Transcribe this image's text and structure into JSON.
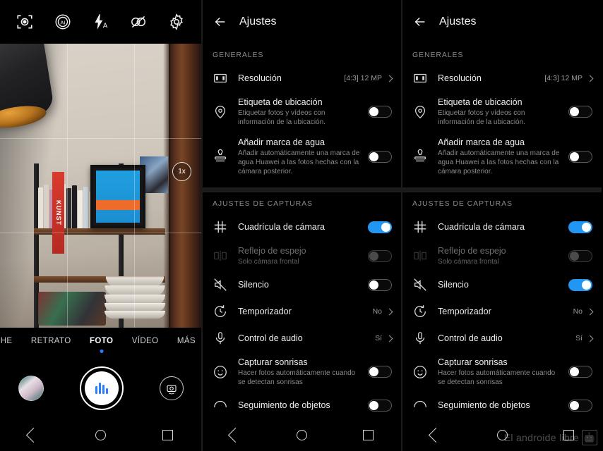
{
  "camera": {
    "topbar_icons": [
      {
        "name": "ai-focus-icon",
        "label": "Enfoque"
      },
      {
        "name": "ai-mode-icon",
        "label": "AI"
      },
      {
        "name": "flash-auto-icon",
        "label": "Flash automático"
      },
      {
        "name": "aperture-icon",
        "label": "Apertura"
      },
      {
        "name": "settings-gear-icon",
        "label": "Ajustes"
      }
    ],
    "zoom_badge": "1x",
    "modes": [
      {
        "label": "CHE",
        "active": false,
        "cut": true
      },
      {
        "label": "RETRATO",
        "active": false,
        "cut": false
      },
      {
        "label": "FOTO",
        "active": true,
        "cut": false
      },
      {
        "label": "VÍDEO",
        "active": false,
        "cut": false
      },
      {
        "label": "MÁS",
        "active": false,
        "cut": false
      }
    ],
    "gallery_thumb_name": "gallery-thumbnail",
    "shutter_name": "shutter-button",
    "flip_name": "flip-camera-button"
  },
  "navbar": {
    "back": "back-nav-button",
    "home": "home-nav-button",
    "recents": "recents-nav-button"
  },
  "watermark": {
    "text": "El androide libre",
    "bot": "🤖"
  },
  "settings": {
    "title": "Ajustes",
    "back_label": "Atrás",
    "sections": [
      {
        "label": "GENERALES",
        "rows": [
          {
            "name": "resolution",
            "icon": "film-frame-icon",
            "title": "Resolución",
            "sub": "",
            "value": "[4:3] 12 MP",
            "control": "chevron",
            "state": "",
            "dim": false
          },
          {
            "name": "location-tag",
            "icon": "location-pin-icon",
            "title": "Etiqueta de ubicación",
            "sub": "Etiquetar fotos y vídeos con información de la ubicación.",
            "value": "",
            "control": "toggle",
            "state": "off",
            "dim": false
          },
          {
            "name": "add-watermark",
            "icon": "stamp-icon",
            "title": "Añadir marca de agua",
            "sub": "Añadir automáticamente una marca de agua Huawei a las fotos hechas con la cámara posterior.",
            "value": "",
            "control": "toggle",
            "state": "off",
            "dim": false
          }
        ]
      },
      {
        "label": "AJUSTES DE CAPTURAS",
        "rows": [
          {
            "name": "camera-grid",
            "icon": "grid-icon",
            "title": "Cuadrícula de cámara",
            "sub": "",
            "value": "",
            "control": "toggle",
            "state": "on",
            "dim": false
          },
          {
            "name": "mirror-reflection",
            "icon": "mirror-icon",
            "title": "Reflejo de espejo",
            "sub": "Solo cámara frontal",
            "value": "",
            "control": "toggle",
            "state": "disabled",
            "dim": true
          },
          {
            "name": "silence",
            "icon": "mute-icon",
            "title": "Silencio",
            "sub": "",
            "value": "",
            "control": "toggle",
            "state": "off",
            "dim": false
          },
          {
            "name": "timer",
            "icon": "timer-icon",
            "title": "Temporizador",
            "sub": "",
            "value": "No",
            "control": "chevron",
            "state": "",
            "dim": false
          },
          {
            "name": "audio-control",
            "icon": "microphone-icon",
            "title": "Control de audio",
            "sub": "",
            "value": "Sí",
            "control": "chevron",
            "state": "",
            "dim": false
          },
          {
            "name": "capture-smiles",
            "icon": "smile-icon",
            "title": "Capturar sonrisas",
            "sub": "Hacer fotos automáticamente cuando se detectan sonrisas",
            "value": "",
            "control": "toggle",
            "state": "off",
            "dim": false
          },
          {
            "name": "object-tracking",
            "icon": "tracking-icon",
            "title": "Seguimiento de objetos",
            "sub": "",
            "value": "",
            "control": "toggle",
            "state": "off",
            "dim": false
          }
        ]
      }
    ],
    "silence_state_right": "on"
  },
  "colors": {
    "accent": "#2196f3",
    "background": "#000000",
    "text_primary": "#ededed",
    "text_secondary": "#8a8a8a"
  }
}
